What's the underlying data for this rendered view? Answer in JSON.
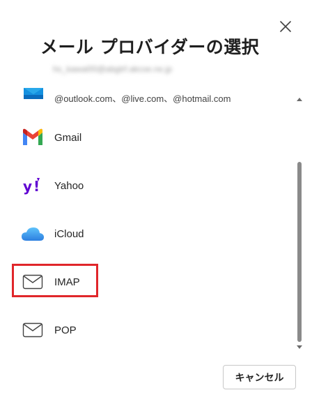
{
  "dialog": {
    "title": "メール プロバイダーの選択",
    "account_email": "hs_kawai00@abgtrf.akcoe.ne.jp",
    "close_icon": "close-icon"
  },
  "providers": [
    {
      "id": "outlook",
      "label": "@outlook.com、@live.com、@hotmail.com",
      "icon": "outlook-icon"
    },
    {
      "id": "gmail",
      "label": "Gmail",
      "icon": "gmail-icon"
    },
    {
      "id": "yahoo",
      "label": "Yahoo",
      "icon": "yahoo-icon"
    },
    {
      "id": "icloud",
      "label": "iCloud",
      "icon": "icloud-icon"
    },
    {
      "id": "imap",
      "label": "IMAP",
      "icon": "envelope-icon"
    },
    {
      "id": "pop",
      "label": "POP",
      "icon": "envelope-icon"
    }
  ],
  "highlight": {
    "target": "imap",
    "color": "#e0262a"
  },
  "footer": {
    "cancel_label": "キャンセル"
  },
  "colors": {
    "yahoo_purple": "#6001d2",
    "icloud_blue": "#3b9df0",
    "outlook_blue": "#0a6cbd"
  }
}
